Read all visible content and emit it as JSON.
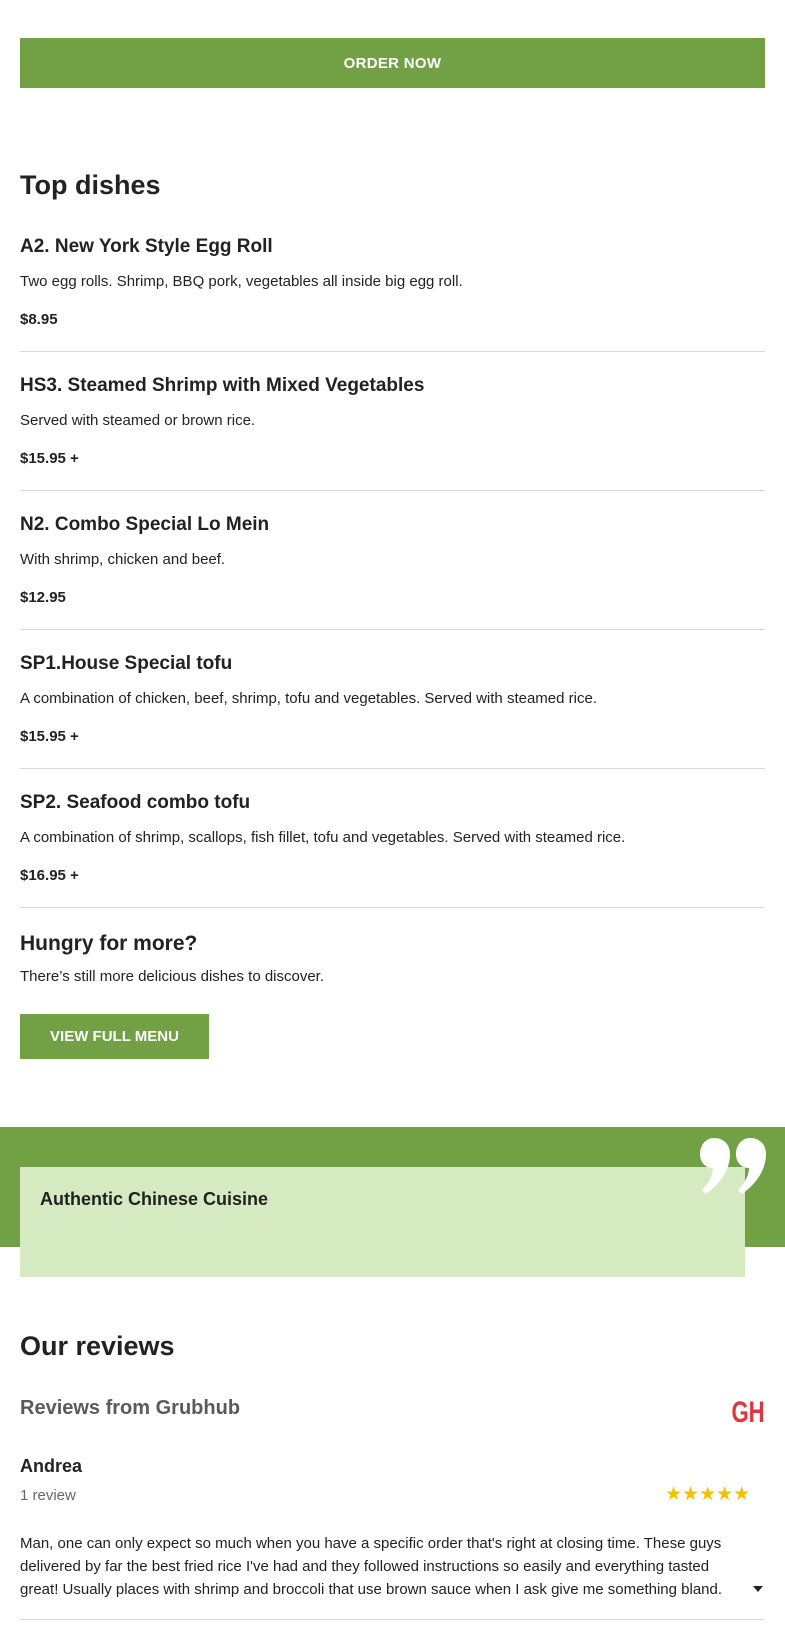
{
  "order_button": "ORDER NOW",
  "top_dishes": {
    "title": "Top dishes",
    "items": [
      {
        "name": "A2. New York Style Egg Roll",
        "description": "Two egg rolls. Shrimp, BBQ pork, vegetables all inside big egg roll.",
        "price": "$8.95"
      },
      {
        "name": "HS3. Steamed Shrimp with Mixed Vegetables",
        "description": "Served with steamed or brown rice.",
        "price": "$15.95 +"
      },
      {
        "name": "N2. Combo Special Lo Mein",
        "description": "With shrimp, chicken and beef.",
        "price": "$12.95"
      },
      {
        "name": "SP1.House Special tofu",
        "description": "A combination of chicken, beef, shrimp, tofu and vegetables. Served with steamed rice.",
        "price": "$15.95 +"
      },
      {
        "name": "SP2. Seafood combo tofu",
        "description": "A combination of shrimp, scallops, fish fillet, tofu and vegetables. Served with steamed rice.",
        "price": "$16.95 +"
      }
    ]
  },
  "more": {
    "title": "Hungry for more?",
    "text": "There’s still more delicious dishes to discover.",
    "button": "VIEW FULL MENU"
  },
  "quote": {
    "text": "Authentic Chinese Cuisine"
  },
  "reviews": {
    "title": "Our reviews",
    "source_title": "Reviews from Grubhub",
    "logo_text": "GH",
    "review": {
      "author": "Andrea",
      "count": "1 review",
      "rating": 5,
      "stars": "★★★★★",
      "text": "Man, one can only expect so much when you have a specific order that's right at closing time. These guys delivered by far the best fried rice I've had and they followed instructions so easily and everything tasted great! Usually places with shrimp and broccoli that use brown sauce when I ask give me something bland. …"
    }
  },
  "colors": {
    "accent": "#71a045",
    "quote_bg": "#d5eac0",
    "grubhub_red": "#e2343f",
    "star": "#f2c200"
  }
}
